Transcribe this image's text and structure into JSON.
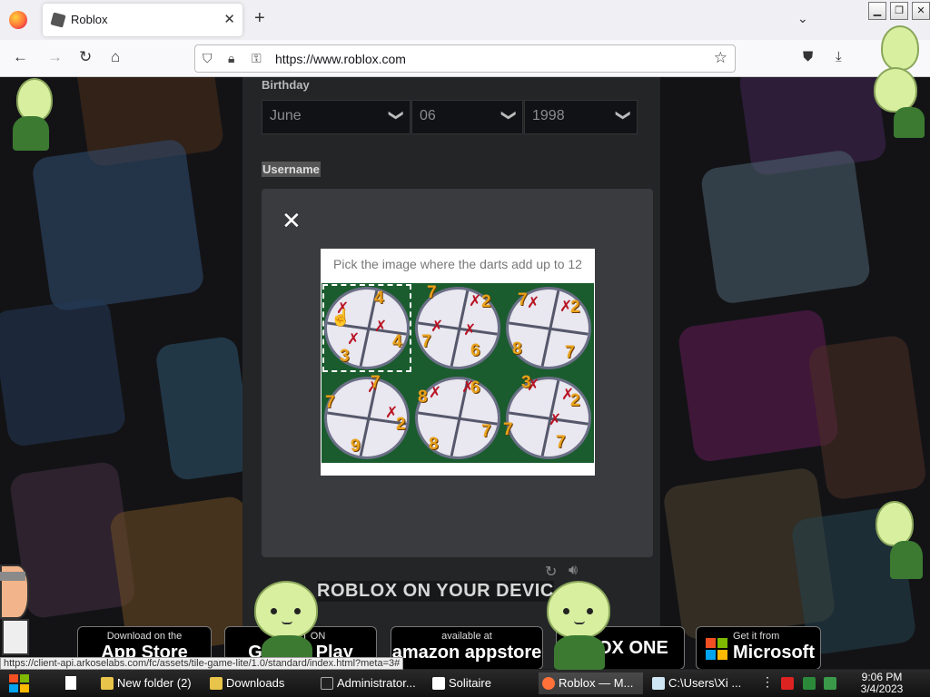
{
  "browser": {
    "tab_title": "Roblox",
    "url": "https://www.roblox.com",
    "new_tab_symbol": "+",
    "tab_list_symbol": "⌄",
    "status_url": "https://client-api.arkoselabs.com/fc/assets/tile-game-lite/1.0/standard/index.html?meta=3#"
  },
  "form": {
    "birthday_label": "Birthday",
    "month": "June",
    "day": "06",
    "year": "1998",
    "username_label": "Username"
  },
  "captcha": {
    "prompt": "Pick the image where the darts add up to 12",
    "tiles": [
      {
        "numbers": [
          "4",
          "3",
          "4"
        ],
        "darts": 3,
        "selected": true
      },
      {
        "numbers": [
          "7",
          "2",
          "7",
          "6"
        ],
        "darts": 2,
        "selected": false
      },
      {
        "numbers": [
          "7",
          "2",
          "8",
          "7"
        ],
        "darts": 2,
        "selected": false
      },
      {
        "numbers": [
          "7",
          "7",
          "2",
          "9"
        ],
        "darts": 2,
        "selected": false
      },
      {
        "numbers": [
          "8",
          "6",
          "8",
          "7"
        ],
        "darts": 2,
        "selected": false
      },
      {
        "numbers": [
          "3",
          "2",
          "7",
          "7"
        ],
        "darts": 3,
        "selected": false
      }
    ]
  },
  "devices": {
    "title": "ROBLOX ON YOUR DEVIC",
    "badges": [
      {
        "small": "Download on the",
        "big": "App Store"
      },
      {
        "small": "GET IT ON",
        "big": "Google Play"
      },
      {
        "small": "available at",
        "big": "amazon appstore"
      },
      {
        "small": "",
        "big": "XBOX ONE"
      },
      {
        "small": "Get it from",
        "big": "Microsoft"
      }
    ]
  },
  "taskbar": {
    "items": [
      "New folder (2)",
      "Downloads",
      "Administrator...",
      "Solitaire",
      "Roblox — M...",
      "C:\\Users\\Xi ..."
    ],
    "time": "9:06 PM",
    "date": "3/4/2023"
  },
  "colors": {
    "accent_orange": "#e9a21b",
    "dart_red": "#b81222",
    "captcha_green": "#1a5c2e"
  }
}
